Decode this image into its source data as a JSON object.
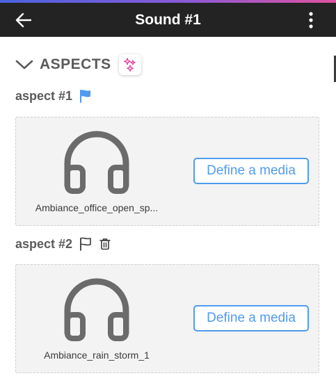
{
  "header": {
    "title": "Sound #1",
    "back_icon": "arrow-left-icon",
    "more_icon": "more-vertical-icon"
  },
  "section": {
    "title": "ASPECTS",
    "toggle_icon": "chevron-down-icon",
    "action_icon": "sparkles-icon"
  },
  "aspects": [
    {
      "label": "aspect #1",
      "flag_icon": "flag-filled-icon",
      "media_icon": "headphones-icon",
      "media_name": "Ambiance_office_open_sp...",
      "button_label": "Define a media"
    },
    {
      "label": "aspect #2",
      "flag_icon": "flag-outline-icon",
      "delete_icon": "trash-icon",
      "media_icon": "headphones-icon",
      "media_name": "Ambiance_rain_storm_1",
      "button_label": "Define a media"
    }
  ],
  "colors": {
    "appbar": "#232323",
    "accent_blue": "#4f9bf0",
    "magic_pink": "#e8379a",
    "card_bg": "#f3f3f3",
    "icon_gray": "#6b6b6b",
    "gradient_start": "#4a63e0",
    "gradient_end": "#e0529e"
  }
}
